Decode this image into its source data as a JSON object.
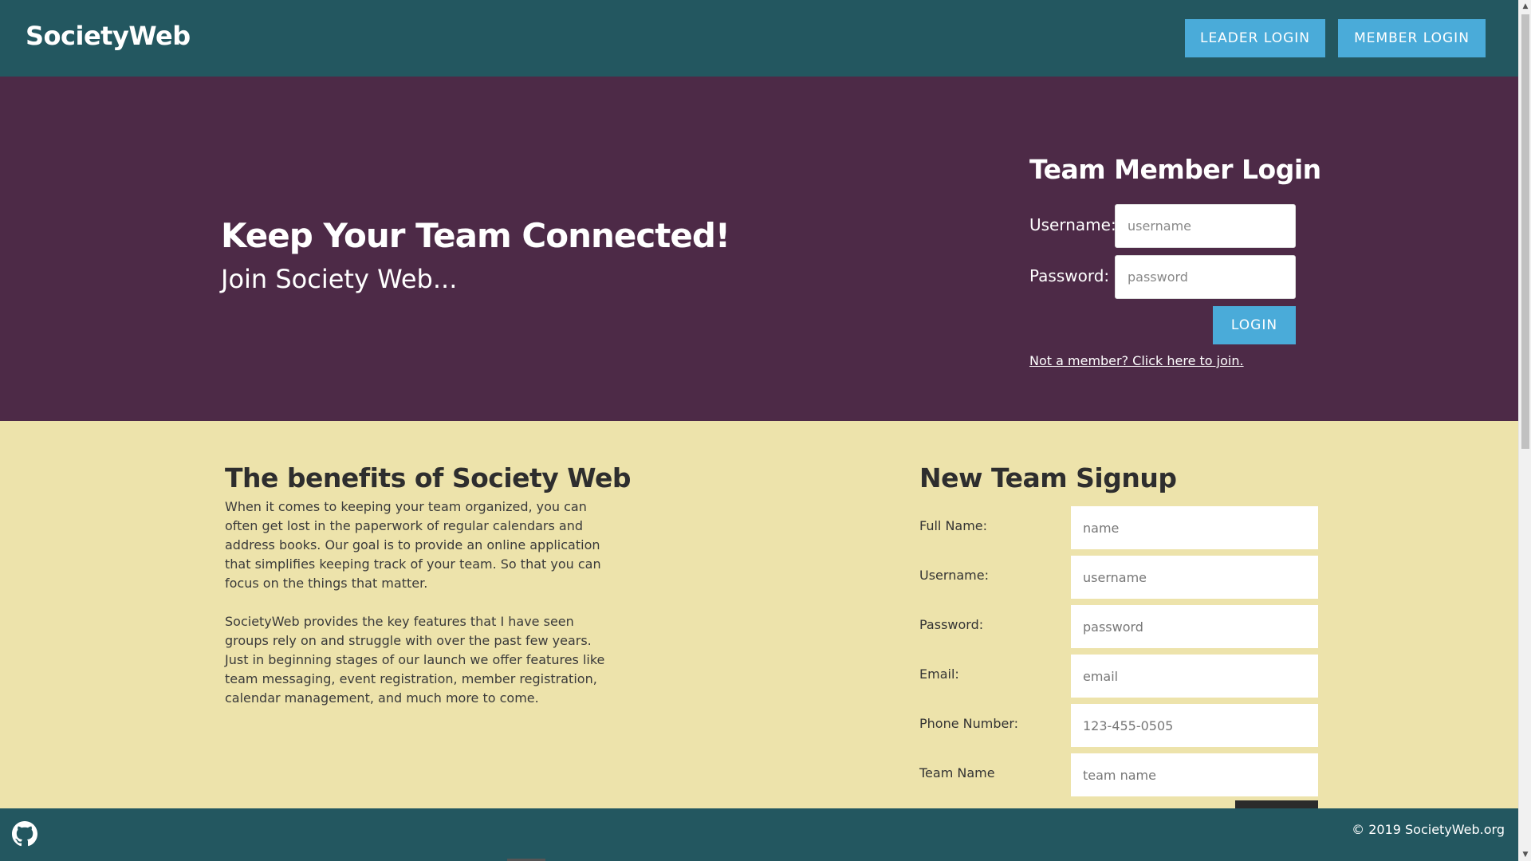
{
  "header": {
    "brand": "SocietyWeb",
    "leader_login_label": "LEADER LOGIN",
    "member_login_label": "MEMBER LOGIN"
  },
  "hero": {
    "title": "Keep Your Team Connected!",
    "subtitle": "Join Society Web..."
  },
  "member_login": {
    "title": "Team Member Login",
    "username_label": "Username:",
    "username_placeholder": "username",
    "password_label": "Password:",
    "password_placeholder": "password",
    "login_label": "LOGIN",
    "join_link": "Not a member? Click here to join."
  },
  "benefits": {
    "title": "The benefits of Society Web",
    "paragraph_1": "When it comes to keeping your team organized, you can often get lost in the paperwork of regular calendars and address books. Our goal is to provide an online application that simplifies keeping track of your team. So that you can focus on the things that matter.",
    "paragraph_2": "SocietyWeb provides the key features that I have seen groups rely on and struggle with over the past few years. Just in beginning stages of our launch we offer features like team messaging, event registration, member registration, calendar management, and much more to come."
  },
  "signup": {
    "title": "New Team Signup",
    "fields": [
      {
        "label": "Full Name:",
        "placeholder": "name"
      },
      {
        "label": "Username:",
        "placeholder": "username"
      },
      {
        "label": "Password:",
        "placeholder": "password"
      },
      {
        "label": "Email:",
        "placeholder": "email"
      },
      {
        "label": "Phone Number:",
        "placeholder": "123-455-0505"
      },
      {
        "label": "Team Name",
        "placeholder": "team name"
      }
    ]
  },
  "footer": {
    "icon": "github-icon",
    "copyright": "© 2019 SocietyWeb.org"
  },
  "colors": {
    "header_bg": "#235760",
    "hero_bg": "#4d2a47",
    "content_bg": "#ede3ab",
    "accent_button": "#4aabd9"
  }
}
